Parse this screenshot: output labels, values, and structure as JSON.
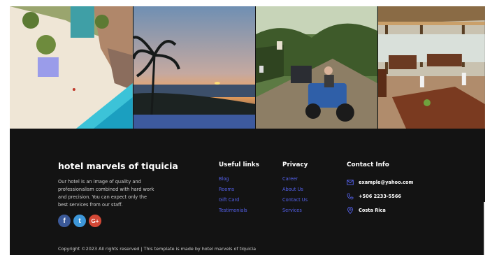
{
  "gallery": {
    "photos": [
      {
        "name": "beach-resort-aerial-photo"
      },
      {
        "name": "sunset-palm-photo"
      },
      {
        "name": "atv-tour-photo"
      },
      {
        "name": "restaurant-interior-photo"
      }
    ]
  },
  "footer": {
    "brand": "hotel marvels of tiquicia",
    "about": "Our hotel is an image of quality and professionalism combined with hard work and precision. You can expect only the best services from our staff.",
    "socials": [
      {
        "icon": "facebook-icon",
        "glyph": "f",
        "color": "#3b5998"
      },
      {
        "icon": "twitter-icon",
        "glyph": "t",
        "color": "#3d97d9"
      },
      {
        "icon": "google-plus-icon",
        "glyph": "G+",
        "color": "#d34836"
      }
    ],
    "useful_links": {
      "title": "Useful links",
      "items": [
        "Blog",
        "Rooms",
        "Gift Card",
        "Testimonials"
      ]
    },
    "privacy": {
      "title": "Privacy",
      "items": [
        "Career",
        "About Us",
        "Contact Us",
        "Services"
      ]
    },
    "contact": {
      "title": "Contact Info",
      "email": "example@yahoo.com",
      "phone": "+506 2233-5566",
      "location": "Costa Rica",
      "accent": "#5562ee"
    },
    "copyright": "Copyright ©2023 All rights reserved | This template is made by hotel marvels of tiquicia"
  }
}
